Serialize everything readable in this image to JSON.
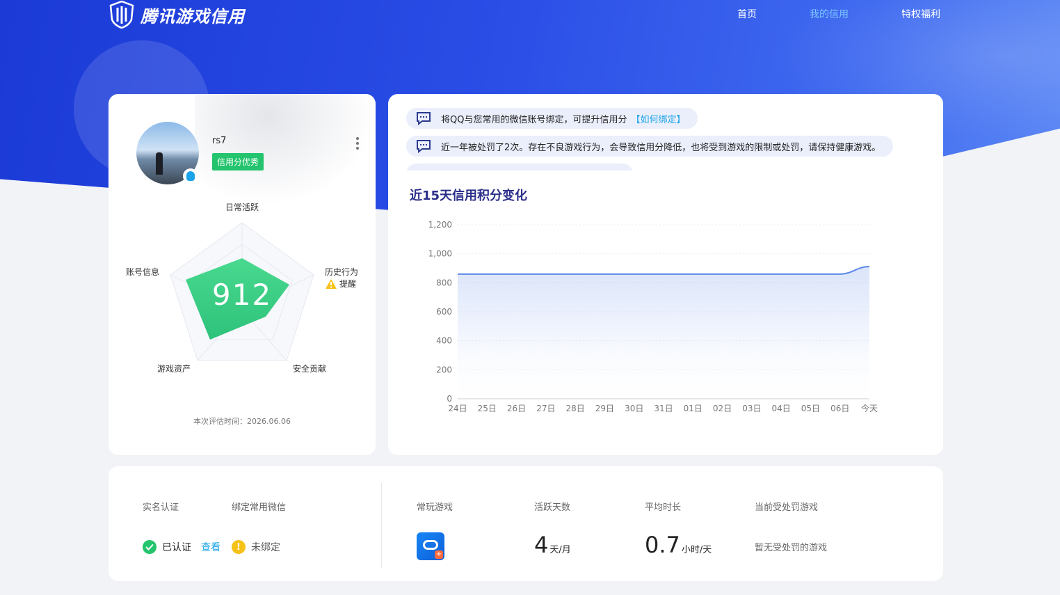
{
  "header": {
    "brand": "腾讯游戏信用",
    "nav": [
      "首页",
      "我的信用",
      "特权福利"
    ],
    "active_nav": "我的信用"
  },
  "profile": {
    "username": "rs7",
    "credit_tag": "信用分优秀",
    "score": "912",
    "radar_labels": {
      "daily": "日常活跃",
      "history": "历史行为",
      "security": "安全贡献",
      "assets": "游戏资产",
      "account": "账号信息"
    },
    "warning": "提醒",
    "eval_time": "本次评估时间：2026.06.06"
  },
  "notices": [
    {
      "text": "将QQ与您常用的微信账号绑定，可提升信用分",
      "link": "【如何绑定】"
    },
    {
      "text": "近一年被处罚了2次。存在不良游戏行为，会导致信用分降低，也将受到游戏的限制或处罚，请保持健康游戏。",
      "link": ""
    }
  ],
  "chart_title": "近15天信用积分变化",
  "chart_data": {
    "type": "area",
    "x": [
      "24日",
      "25日",
      "26日",
      "27日",
      "28日",
      "29日",
      "30日",
      "31日",
      "01日",
      "02日",
      "03日",
      "04日",
      "05日",
      "06日",
      "今天"
    ],
    "series": [
      {
        "values": [
          860,
          860,
          860,
          860,
          860,
          860,
          860,
          860,
          860,
          860,
          860,
          860,
          860,
          860,
          912
        ]
      }
    ],
    "yticks": [
      "0",
      "200",
      "400",
      "600",
      "800",
      "1,000",
      "1,200"
    ],
    "ylim": [
      0,
      1200
    ],
    "line_color": "#5b87e8",
    "grid": true
  },
  "bottom": {
    "labels": {
      "realname": "实名认证",
      "wechat": "绑定常用微信",
      "games": "常玩游戏",
      "active_days": "活跃天数",
      "avg_time": "平均时长",
      "punished": "当前受处罚游戏"
    },
    "verified": "已认证",
    "view": "查看",
    "unbound": "未绑定",
    "active_days_value": "4",
    "active_days_unit": "天/月",
    "avg_time_value": "0.7",
    "avg_time_unit": "小时/天",
    "punished_none": "暂无受处罚的游戏"
  },
  "colors": {
    "accent": "#2a4de6",
    "success": "#23c46d",
    "warning": "#f5c21a",
    "link": "#1aa3e8"
  }
}
